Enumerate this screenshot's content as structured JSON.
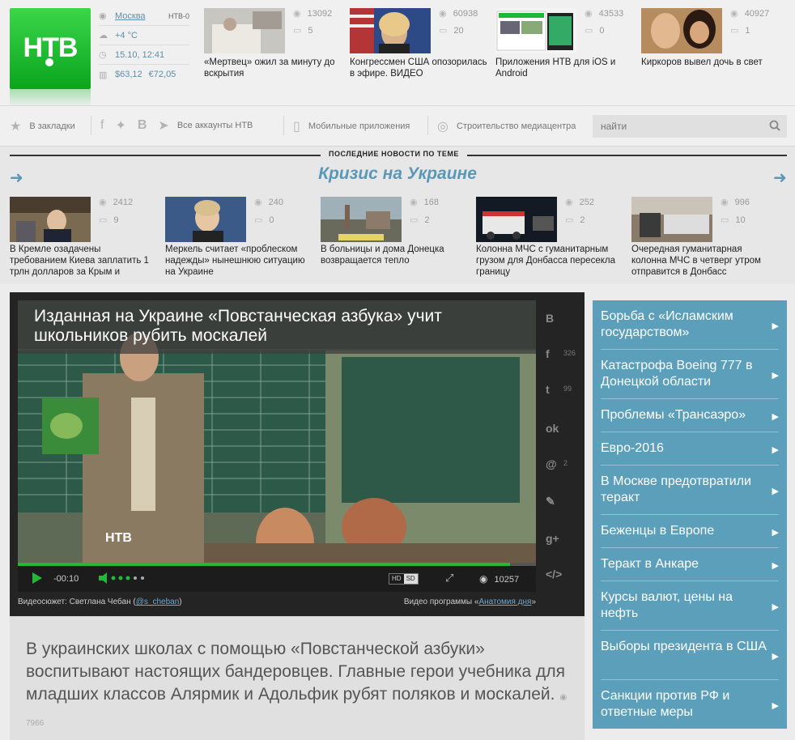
{
  "header": {
    "logo_text": "НТВ",
    "info": {
      "city": "Москва",
      "channel": "НТВ-0",
      "weather": "+4 °C",
      "datetime": "15.10, 12:41",
      "usd": "$63,12",
      "eur": "€72,05"
    },
    "top_news": [
      {
        "views": "13092",
        "comments": "5",
        "title": "«Мертвец» ожил за минуту до вскрытия"
      },
      {
        "views": "60938",
        "comments": "20",
        "title": "Конгрессмен США опозорилась в эфире. ВИДЕО"
      },
      {
        "views": "43533",
        "comments": "0",
        "title": "Приложения НТВ для iOS и Android"
      },
      {
        "views": "40927",
        "comments": "1",
        "title": "Киркоров вывел дочь в свет"
      }
    ]
  },
  "toolbar": {
    "bookmarks": "В закладки",
    "all_accounts": "Все аккаунты НТВ",
    "mobile_apps": "Мобильные приложения",
    "media_center": "Строительство медиацентра",
    "search_placeholder": "найти"
  },
  "crisis": {
    "kicker": "ПОСЛЕДНИЕ НОВОСТИ ПО ТЕМЕ",
    "headline": "Кризис на Украине",
    "items": [
      {
        "views": "2412",
        "comments": "9",
        "title": "В Кремле озадачены требованием Киева заплатить 1 трлн долларов за Крым и"
      },
      {
        "views": "240",
        "comments": "0",
        "title": "Меркель считает «проблеском надежды» нынешнюю ситуацию на Украине"
      },
      {
        "views": "168",
        "comments": "2",
        "title": "В больницы и дома Донецка возвращается тепло"
      },
      {
        "views": "252",
        "comments": "2",
        "title": "Колонна МЧС с гуманитарным грузом для Донбасса пересекла границу"
      },
      {
        "views": "996",
        "comments": "10",
        "title": "Очередная гуманитарная колонна МЧС в четверг утром отправится в Донбасс"
      }
    ]
  },
  "video": {
    "title": "Изданная на Украине «Повстанческая азбука» учит школьников рубить москалей",
    "time": "-00:10",
    "progress": 0.95,
    "hd": "HD",
    "sd": "SD",
    "views": "10257",
    "credit_prefix": "Видеосюжет: Светлана Чебан (",
    "credit_handle": "@s_cheban",
    "credit_suffix": ")",
    "program_prefix": "Видео программы «",
    "program_name": "Анатомия дня",
    "program_suffix": "»",
    "share": [
      {
        "glyph": "В",
        "count": ""
      },
      {
        "glyph": "f",
        "count": "326"
      },
      {
        "glyph": "t",
        "count": "99"
      },
      {
        "glyph": "ok",
        "count": ""
      },
      {
        "glyph": "@",
        "count": "2"
      },
      {
        "glyph": "✎",
        "count": ""
      },
      {
        "glyph": "g+",
        "count": ""
      },
      {
        "glyph": "</>",
        "count": ""
      }
    ]
  },
  "lead": {
    "text": "В украинских школах с помощью «Повстанческой азбуки» воспитывают настоящих бандеровцев. Главные герои учебника для младших классов Алярмик и Адольфик рубят поляков и москалей.",
    "views": "7966"
  },
  "menu": [
    "Борьба с «Исламским государством»",
    "Катастрофа Boeing 777 в Донецкой области",
    "Проблемы «Трансаэро»",
    "Евро-2016",
    "В Москве предотвратили теракт",
    "Беженцы в Европе",
    "Теракт в Анкаре",
    "Курсы валют, цены на нефть",
    "Выборы президента в США",
    "Санкции против РФ и ответные меры"
  ],
  "colors": {
    "brand_green": "#1cb833",
    "accent_blue": "#5a98b8",
    "menu_bg": "#5b9fbb"
  }
}
